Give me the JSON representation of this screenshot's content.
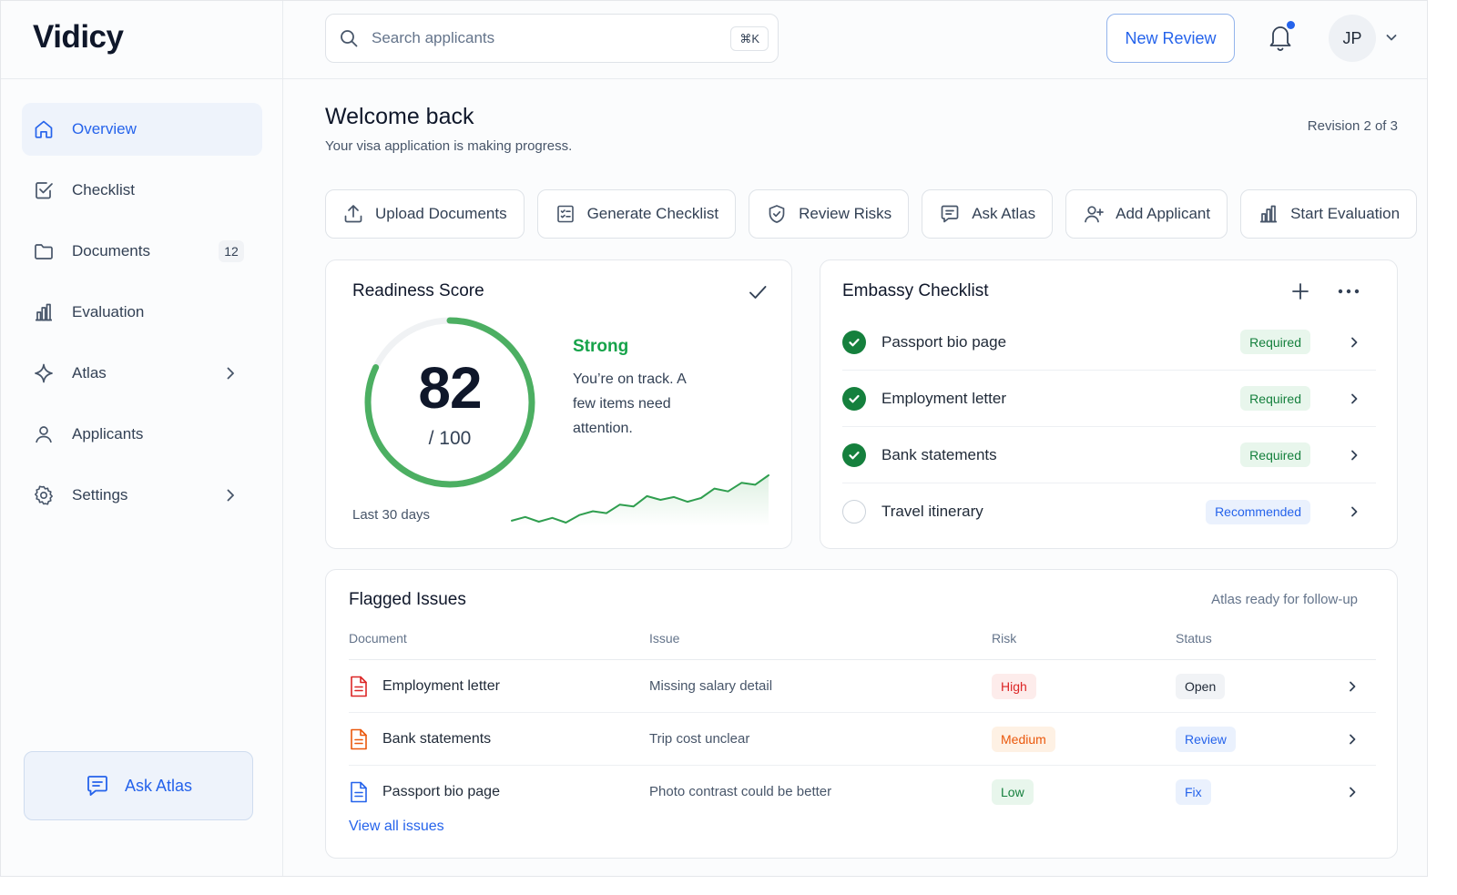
{
  "app": {
    "name": "Vidicy"
  },
  "sidebar": {
    "items": [
      {
        "label": "Overview",
        "icon": "home-icon",
        "active": true
      },
      {
        "label": "Checklist",
        "icon": "checkbox-icon"
      },
      {
        "label": "Documents",
        "icon": "folder-icon",
        "count": "12"
      },
      {
        "label": "Evaluation",
        "icon": "bar-chart-icon"
      },
      {
        "label": "Atlas",
        "icon": "sparkle-icon",
        "has_submenu": true
      },
      {
        "label": "Applicants",
        "icon": "user-icon"
      },
      {
        "label": "Settings",
        "icon": "gear-icon",
        "has_submenu": true
      }
    ],
    "ask_atlas_label": "Ask Atlas"
  },
  "header": {
    "search_placeholder": "Search applicants",
    "search_shortcut": "⌘K",
    "new_review_label": "New Review",
    "has_notification": true,
    "avatar_initials": "JP"
  },
  "page": {
    "title": "Welcome back",
    "subtitle": "Your visa application is making progress.",
    "revision": "Revision 2 of 3"
  },
  "actions": [
    {
      "label": "Upload Documents",
      "icon": "upload-icon"
    },
    {
      "label": "Generate Checklist",
      "icon": "checklist-icon"
    },
    {
      "label": "Review Risks",
      "icon": "shield-icon"
    },
    {
      "label": "Ask Atlas",
      "icon": "chat-icon"
    },
    {
      "label": "Add Applicant",
      "icon": "user-plus-icon"
    },
    {
      "label": "Start Evaluation",
      "icon": "bar-chart-icon"
    }
  ],
  "readiness": {
    "title": "Readiness Score",
    "score": "82",
    "out_of": "/ 100",
    "score_fraction": 0.82,
    "status": "Strong",
    "description": "You’re on track. A few items need attention.",
    "period": "Last 30 days",
    "trend": [
      10,
      14,
      9,
      13,
      8,
      16,
      20,
      18,
      27,
      25,
      36,
      32,
      35,
      30,
      34,
      44,
      41,
      50,
      48,
      58
    ]
  },
  "embassy": {
    "title": "Embassy Checklist",
    "items": [
      {
        "name": "Passport bio page",
        "done": true,
        "tag": "Required",
        "tag_type": "req"
      },
      {
        "name": "Employment letter",
        "done": true,
        "tag": "Required",
        "tag_type": "req"
      },
      {
        "name": "Bank statements",
        "done": true,
        "tag": "Required",
        "tag_type": "req"
      },
      {
        "name": "Travel itinerary",
        "done": false,
        "tag": "Recommended",
        "tag_type": "rec"
      }
    ]
  },
  "flagged": {
    "title": "Flagged Issues",
    "note": "Atlas ready for follow-up",
    "columns": {
      "document": "Document",
      "issue": "Issue",
      "risk": "Risk",
      "status": "Status"
    },
    "rows": [
      {
        "document": "Employment letter",
        "issue": "Missing salary detail",
        "risk": "High",
        "risk_level": "high",
        "status": "Open",
        "status_type": "open",
        "doc_color": "#dc2626"
      },
      {
        "document": "Bank statements",
        "issue": "Trip cost unclear",
        "risk": "Medium",
        "risk_level": "medium",
        "status": "Review",
        "status_type": "review",
        "doc_color": "#ea580c"
      },
      {
        "document": "Passport bio page",
        "issue": "Photo contrast could be better",
        "risk": "Low",
        "risk_level": "low",
        "status": "Fix",
        "status_type": "fix",
        "doc_color": "#2563eb"
      }
    ],
    "view_all_label": "View all issues"
  }
}
